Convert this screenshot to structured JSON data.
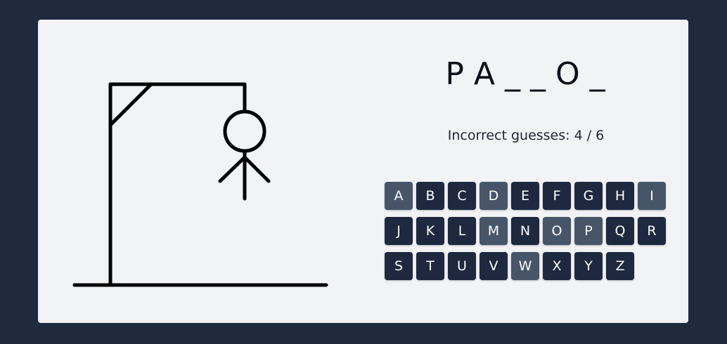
{
  "colors": {
    "page_background": "#1f2a3f",
    "card_background": "#f2f3f5",
    "key_active": "#1e2940",
    "key_used": "#475569",
    "drawing": "#000000"
  },
  "game": {
    "word_display": "P A _ _ O _",
    "status_text": "Incorrect guesses: 4 / 6",
    "incorrect_guesses": 4,
    "max_incorrect": 6
  },
  "hangman": {
    "parts_shown": [
      "head",
      "body",
      "left-arm",
      "right-arm"
    ]
  },
  "keyboard": {
    "keys": [
      {
        "label": "A",
        "used": true
      },
      {
        "label": "B",
        "used": false
      },
      {
        "label": "C",
        "used": false
      },
      {
        "label": "D",
        "used": true
      },
      {
        "label": "E",
        "used": false
      },
      {
        "label": "F",
        "used": false
      },
      {
        "label": "G",
        "used": false
      },
      {
        "label": "H",
        "used": false
      },
      {
        "label": "I",
        "used": true
      },
      {
        "label": "J",
        "used": false
      },
      {
        "label": "K",
        "used": false
      },
      {
        "label": "L",
        "used": false
      },
      {
        "label": "M",
        "used": true
      },
      {
        "label": "N",
        "used": false
      },
      {
        "label": "O",
        "used": true
      },
      {
        "label": "P",
        "used": true
      },
      {
        "label": "Q",
        "used": false
      },
      {
        "label": "R",
        "used": false
      },
      {
        "label": "S",
        "used": false
      },
      {
        "label": "T",
        "used": false
      },
      {
        "label": "U",
        "used": false
      },
      {
        "label": "V",
        "used": false
      },
      {
        "label": "W",
        "used": true
      },
      {
        "label": "X",
        "used": false
      },
      {
        "label": "Y",
        "used": false
      },
      {
        "label": "Z",
        "used": false
      }
    ]
  }
}
